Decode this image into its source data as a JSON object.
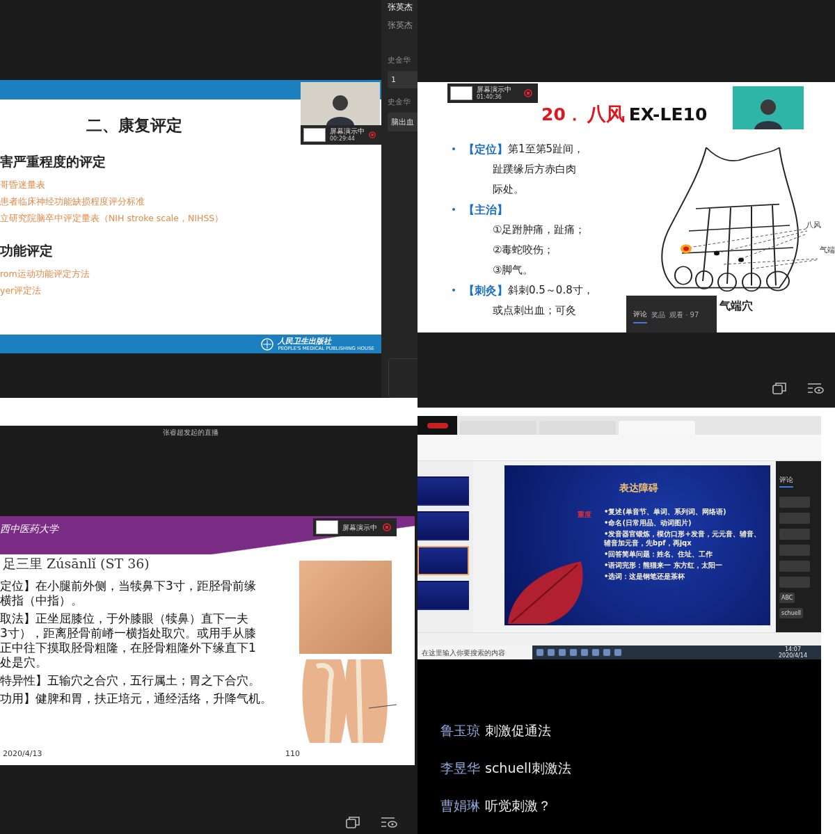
{
  "top_left": {
    "sidebar": [
      {
        "kind": "title",
        "text": "张英杰"
      },
      {
        "kind": "subtitle",
        "text": "张英杰"
      },
      {
        "kind": "name",
        "text": "史金华"
      },
      {
        "kind": "message",
        "text": "1"
      },
      {
        "kind": "name",
        "text": "史金华"
      },
      {
        "kind": "message",
        "text": "脑出血"
      }
    ],
    "share_badge": {
      "label": "屏幕演示中",
      "time": "00:29:44"
    },
    "slide": {
      "title": "二、康复评定",
      "sections": [
        {
          "heading": "害严重程度的评定",
          "items": [
            "哥昏迷量表",
            "患者临床神经功能缺损程度评分标准",
            "立研究院脑卒中评定量表（NIH stroke scale，NIHSS）"
          ]
        },
        {
          "heading": "功能评定",
          "items": [
            "rom运动功能评定方法",
            "yer评定法"
          ]
        }
      ],
      "publisher": "人民卫生出版社",
      "publisher_en": "PEOPLE'S MEDICAL PUBLISHING HOUSE"
    }
  },
  "top_right": {
    "share_badge": {
      "label": "屏幕演示中",
      "time": "01:40:36"
    },
    "slide": {
      "number": "20．",
      "name": "八风",
      "code": "EX-LE10",
      "bullets": [
        {
          "label": "【定位】",
          "text": "第1至第5趾间，",
          "lines": [
            "趾蹼缘后方赤白肉",
            "际处。"
          ]
        },
        {
          "label": "【主治】",
          "lines": [
            "①足跗肿痛，趾痛；",
            "②毒蛇咬伤；",
            "③脚气。"
          ]
        },
        {
          "label": "【刺灸】",
          "text": "斜刺0.5～0.8寸，",
          "lines": [
            "或点刺出血；可灸"
          ]
        }
      ],
      "figure_labels": [
        {
          "kind": "point",
          "text": "八风"
        },
        {
          "kind": "point",
          "text": "气端"
        },
        {
          "kind": "caption",
          "text": "气端穴"
        }
      ]
    },
    "overlay_tabs": [
      {
        "label": "评论",
        "selected": true
      },
      {
        "label": "奖品",
        "selected": false
      },
      {
        "label": "观看 · 97",
        "selected": false
      }
    ]
  },
  "bottom_left": {
    "stream_title": "张睿超发起的直播",
    "share_badge": {
      "label": "屏幕演示中"
    },
    "slide": {
      "logo": "西中医药大学",
      "point": "足三里 Zúsānlǐ (ST 36)",
      "paragraphs": [
        [
          "定位】在小腿前外侧，当犊鼻下3寸，距胫骨前缘",
          "横指（中指）。"
        ],
        [
          "取法】正坐屈膝位，于外膝眼（犊鼻）直下一夫",
          "3寸），距离胫骨前嵴一横指处取穴。或用手从膝",
          "正中往下摸取胫骨粗隆，在胫骨粗隆外下缘直下1",
          "处是穴。"
        ],
        [
          "特异性】五输穴之合穴，五行属土；胃之下合穴。"
        ],
        [
          "功用】健脾和胃，扶正培元，通经活络，升降气机。"
        ]
      ],
      "date": "2020/4/13",
      "page": "110"
    }
  },
  "bottom_right": {
    "doc_tabs": [
      {
        "selected": false
      },
      {
        "selected": false
      },
      {
        "selected": true
      }
    ],
    "thumbnails": [
      {
        "selected": false
      },
      {
        "selected": false
      },
      {
        "selected": true
      },
      {
        "selected": false
      }
    ],
    "slide": {
      "title": "表达障碍",
      "level": "重度",
      "lines": [
        "•复述(单音节、单词、系列词、网络语)",
        "•命名(日常用品、动词图片)",
        "•发音器官锻炼，模仿口形+发音，元元音、辅音、辅音加元音，先bpf，再jqx",
        "•回答简单问题：姓名、住址、工作",
        "•语词完形：熊猫来一 东方红，太阳一",
        "•选词：这是钢笔还是茶杯"
      ]
    },
    "comments": {
      "tab": "评论",
      "items": [
        "ABC",
        "schuell"
      ]
    },
    "taskbar": {
      "search_placeholder": "在这里输入你要搜索的内容",
      "time": "14:07",
      "date": "2020/4/14"
    },
    "chat": [
      {
        "name": "鲁玉琼",
        "text": "刺激促通法"
      },
      {
        "name": "李昱华",
        "text": "schuell刺激法"
      },
      {
        "name": "曹娟琳",
        "text": "听觉刺激？"
      }
    ]
  }
}
